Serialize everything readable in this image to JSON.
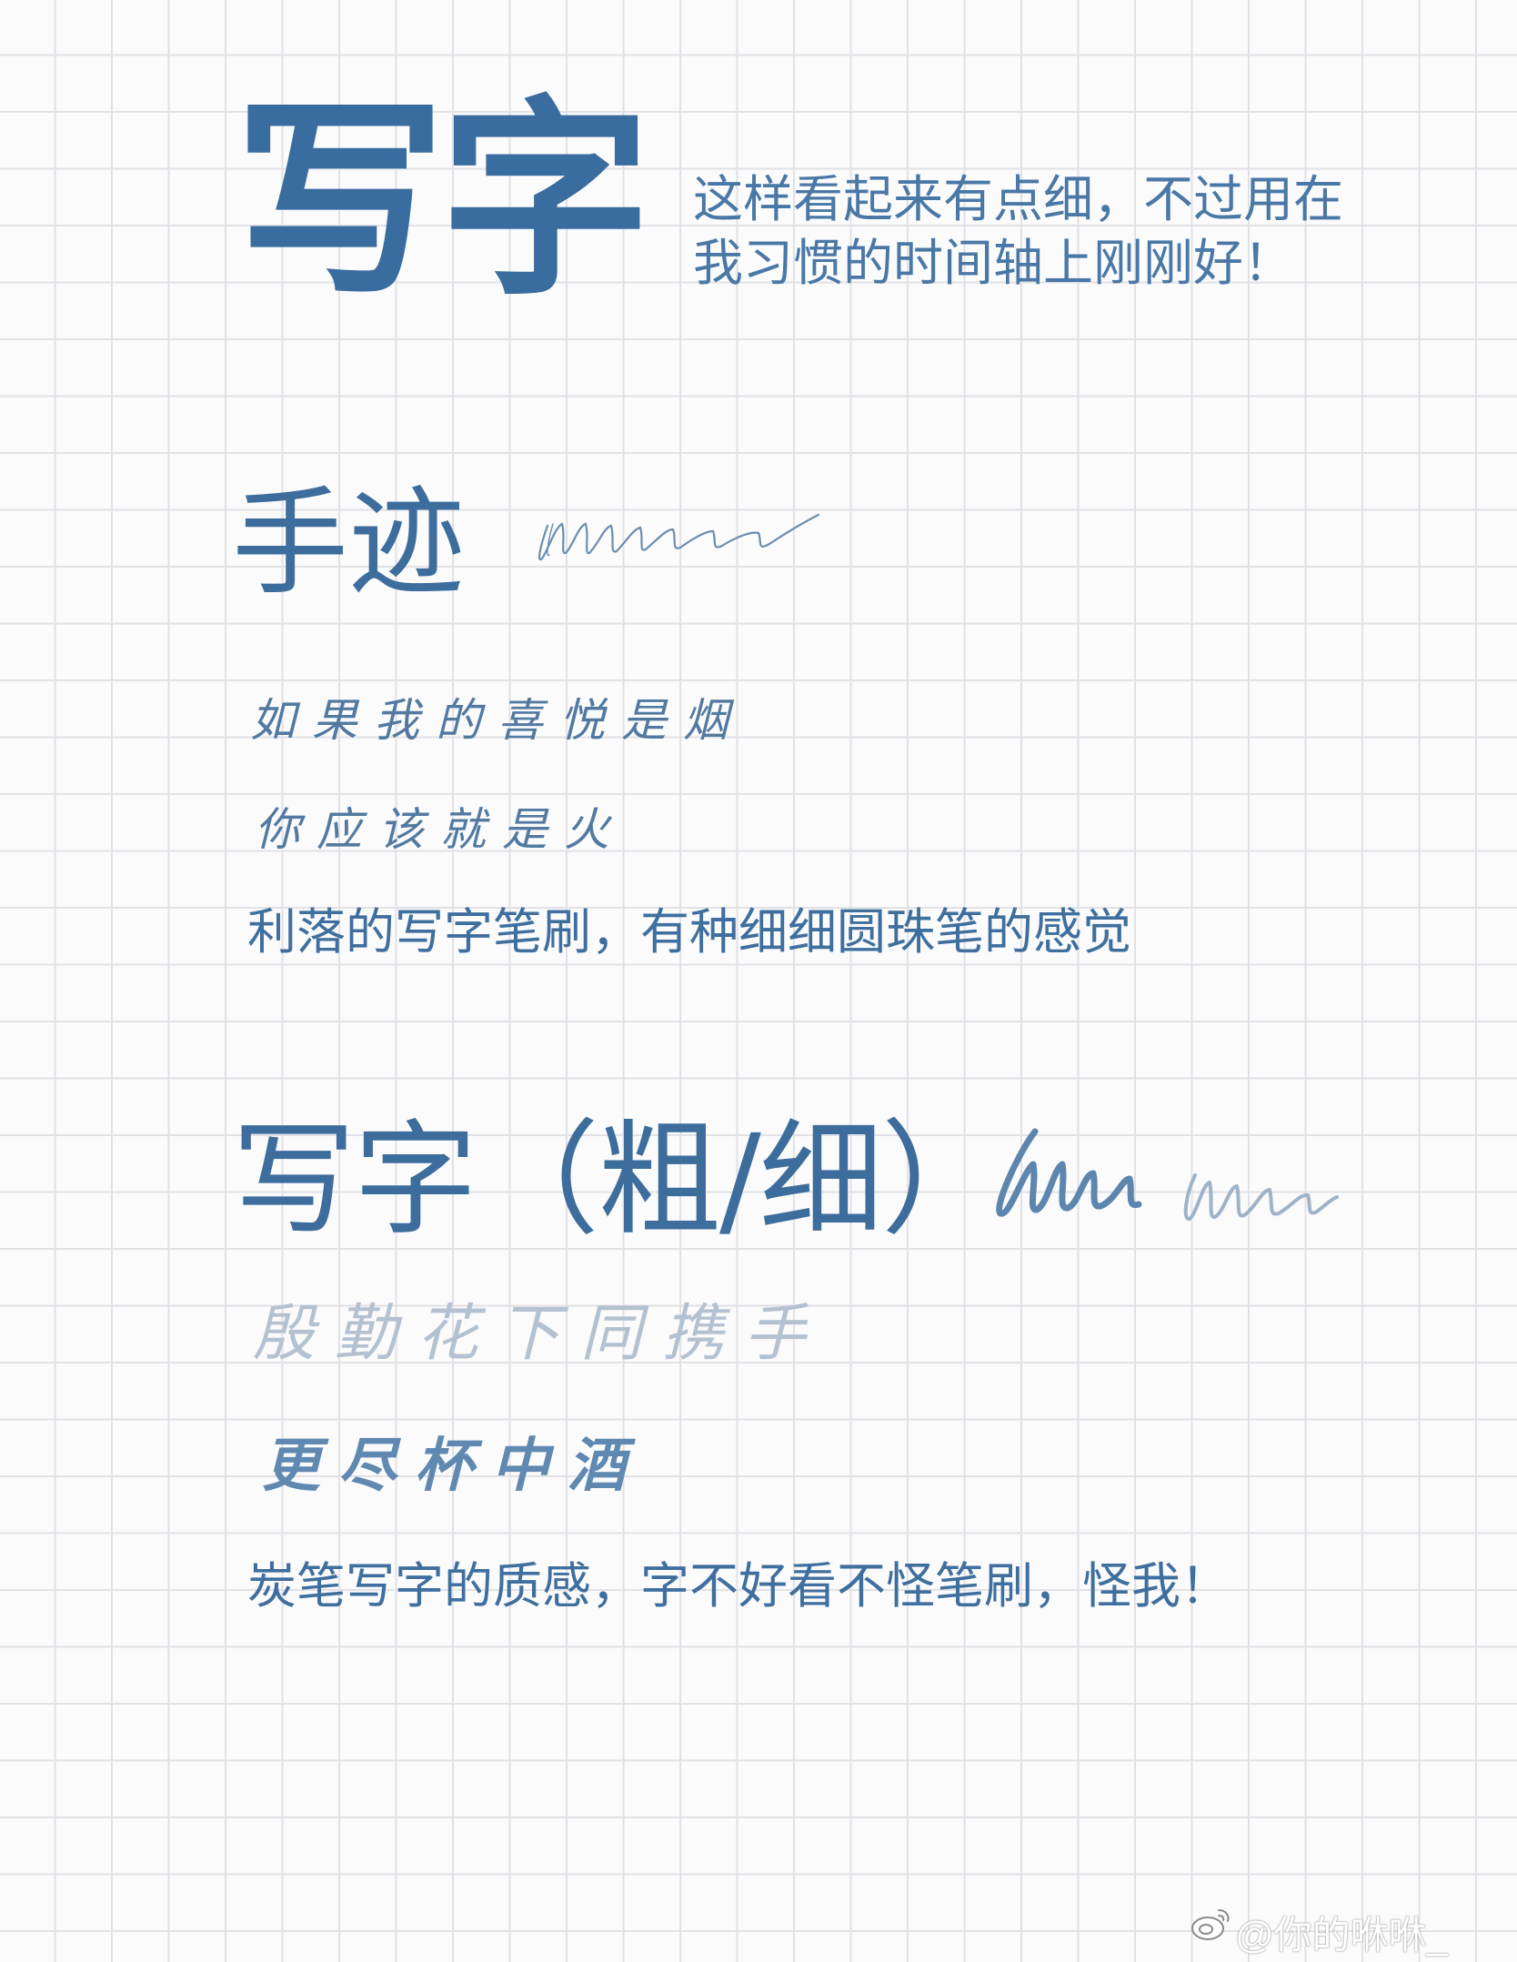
{
  "header": {
    "title": "写字",
    "intro_lines": [
      "这样看起来有点细，不过用在",
      "我习惯的时间轴上刚刚好！"
    ]
  },
  "section_handwriting": {
    "title": "手迹",
    "sample_lines": [
      "如果我的喜悦是烟",
      "你应该就是火"
    ],
    "description": "利落的写字笔刷，有种细细圆珠笔的感觉"
  },
  "section_charcoal": {
    "title": "写字（粗/细）",
    "sample_lines": [
      "殷勤花下同携手",
      "更尽杯中酒"
    ],
    "description": "炭笔写字的质感，字不好看不怪笔刷，怪我！"
  },
  "watermark": {
    "text": "@你的咻咻_"
  },
  "colors": {
    "primary_blue": "#3a6d9f",
    "light_blue": "#b3c1d1",
    "grid_line": "#e2e2e6",
    "background": "#fbfbfc"
  },
  "icons": {
    "stroke_sample_thin": "scribble-thin-icon",
    "stroke_sample_thick": "scribble-thick-icon",
    "stroke_sample_light": "scribble-light-icon",
    "weibo": "weibo-logo-icon"
  }
}
